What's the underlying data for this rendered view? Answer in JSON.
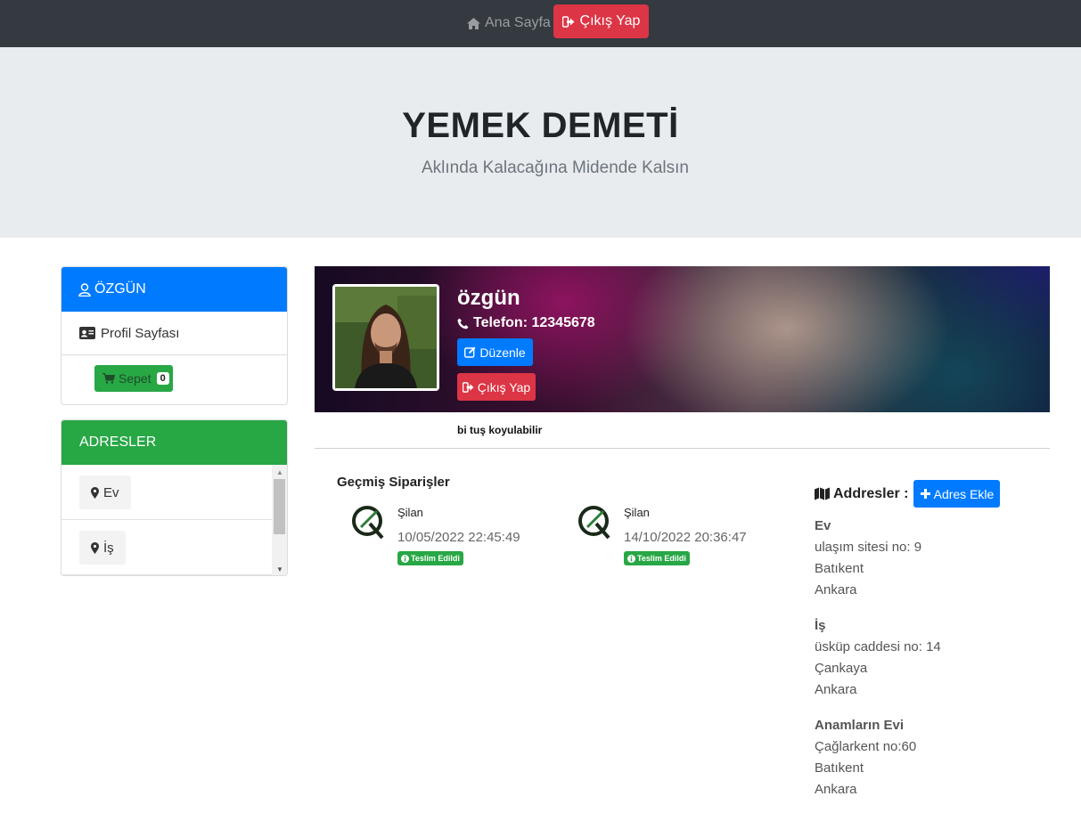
{
  "nav": {
    "home_label": "Ana Sayfa",
    "logout_label": "Çıkış Yap"
  },
  "jumbotron": {
    "title": "YEMEK DEMETİ",
    "subtitle": "Aklında Kalacağına Midende Kalsın"
  },
  "sidebar": {
    "user_name": "ÖZGÜN",
    "profile_link": "Profil Sayfası",
    "cart_label": "Sepet",
    "cart_count": "0",
    "addresses_title": "ADRESLER",
    "address_items": [
      "Ev",
      "İş"
    ]
  },
  "profile": {
    "name": "özgün",
    "phone": "Telefon: 12345678",
    "edit_label": "Düzenle",
    "logout_label": "Çıkış Yap",
    "note": "bi tuş koyulabilir"
  },
  "orders": {
    "title": "Geçmiş Siparişler",
    "items": [
      {
        "restaurant": "Şilan",
        "date": "10/05/2022 22:45:49",
        "status": "Teslim Edildi"
      },
      {
        "restaurant": "Şilan",
        "date": "14/10/2022 20:36:47",
        "status": "Teslim Edildi"
      }
    ]
  },
  "addresses": {
    "label": "Addresler :",
    "add_label": "Adres Ekle",
    "items": [
      {
        "title": "Ev",
        "line1": "ulaşım sitesi no: 9",
        "district": "Batıkent",
        "city": "Ankara"
      },
      {
        "title": "İş",
        "line1": "üsküp caddesi no: 14",
        "district": "Çankaya",
        "city": "Ankara"
      },
      {
        "title": "Anamların Evi",
        "line1": "Çağlarkent no:60",
        "district": "Batıkent",
        "city": "Ankara"
      }
    ]
  },
  "colors": {
    "navbar": "#343a40",
    "primary": "#007bff",
    "danger": "#dc3545",
    "success": "#28a745",
    "jumbotron": "#e9ecef"
  }
}
